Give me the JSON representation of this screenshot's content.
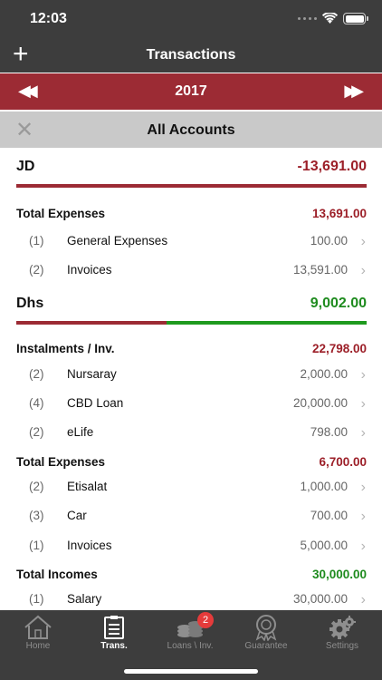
{
  "status": {
    "time": "12:03"
  },
  "nav": {
    "title": "Transactions",
    "add_label": "+"
  },
  "year_nav": {
    "year": "2017",
    "prev_label": "◀◀",
    "next_label": "▶▶"
  },
  "account_filter": {
    "title": "All Accounts",
    "close_label": "✕"
  },
  "currencies": [
    {
      "code": "JD",
      "total": "-13,691.00",
      "groups": [
        {
          "name": "Total Expenses",
          "total": "13,691.00",
          "items": [
            {
              "count": "(1)",
              "name": "General Expenses",
              "amount": "100.00"
            },
            {
              "count": "(2)",
              "name": "Invoices",
              "amount": "13,591.00"
            }
          ]
        }
      ]
    },
    {
      "code": "Dhs",
      "total": "9,002.00",
      "groups": [
        {
          "name": "Instalments / Inv.",
          "total": "22,798.00",
          "items": [
            {
              "count": "(2)",
              "name": "Nursaray",
              "amount": "2,000.00"
            },
            {
              "count": "(4)",
              "name": "CBD Loan",
              "amount": "20,000.00"
            },
            {
              "count": "(2)",
              "name": "eLife",
              "amount": "798.00"
            }
          ]
        },
        {
          "name": "Total Expenses",
          "total": "6,700.00",
          "items": [
            {
              "count": "(2)",
              "name": "Etisalat",
              "amount": "1,000.00"
            },
            {
              "count": "(3)",
              "name": "Car",
              "amount": "700.00"
            },
            {
              "count": "(1)",
              "name": "Invoices",
              "amount": "5,000.00"
            }
          ]
        },
        {
          "name": "Total Incomes",
          "total": "30,000.00",
          "items": [
            {
              "count": "(1)",
              "name": "Salary",
              "amount": "30,000.00"
            }
          ]
        }
      ]
    }
  ],
  "tabs": [
    {
      "label": "Home",
      "icon": "home-icon"
    },
    {
      "label": "Trans.",
      "icon": "transactions-icon"
    },
    {
      "label": "Loans \\ Inv.",
      "icon": "coins-icon",
      "badge": "2"
    },
    {
      "label": "Guarantee",
      "icon": "award-icon"
    },
    {
      "label": "Settings",
      "icon": "gear-icon"
    }
  ],
  "colors": {
    "header_bg": "#3d3d3d",
    "year_bar": "#9c2b34",
    "negative": "#9c1f28",
    "positive": "#1e8b1e",
    "badge": "#e53b3b"
  }
}
